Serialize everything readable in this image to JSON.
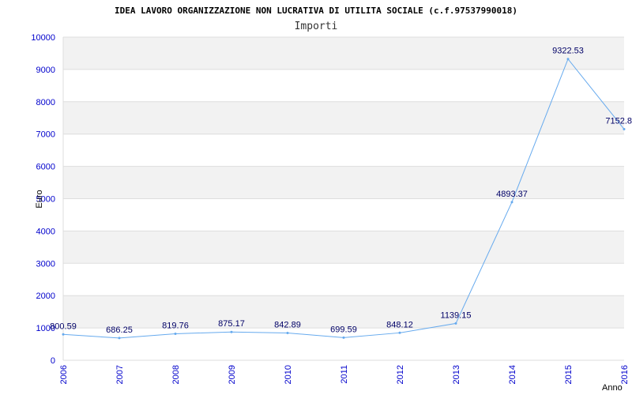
{
  "chart_data": {
    "type": "line",
    "title": "IDEA LAVORO ORGANIZZAZIONE NON LUCRATIVA DI UTILITA SOCIALE (c.f.97537990018)",
    "subtitle": "Importi",
    "xlabel": "Anno",
    "ylabel": "Euro",
    "categories": [
      "2006",
      "2007",
      "2008",
      "2009",
      "2010",
      "2011",
      "2012",
      "2013",
      "2014",
      "2015",
      "2016"
    ],
    "series": [
      {
        "values": [
          800.59,
          686.25,
          819.76,
          875.17,
          842.89,
          699.59,
          848.12,
          1139.15,
          4893.37,
          9322.53,
          7152.8
        ],
        "labels": [
          "800.59",
          "686.25",
          "819.76",
          "875.17",
          "842.89",
          "699.59",
          "848.12",
          "1139.15",
          "4893.37",
          "9322.53",
          "7152.8"
        ]
      }
    ],
    "ylim": [
      0,
      10000
    ],
    "yticks": [
      "0",
      "1000",
      "2000",
      "3000",
      "4000",
      "5000",
      "6000",
      "7000",
      "8000",
      "9000",
      "10000"
    ],
    "grid": true,
    "colors": {
      "line": "#66aaee",
      "band": "#f2f2f2",
      "grid": "#dddddd",
      "tick_text": "#0000cc",
      "data_label": "#000066"
    }
  }
}
